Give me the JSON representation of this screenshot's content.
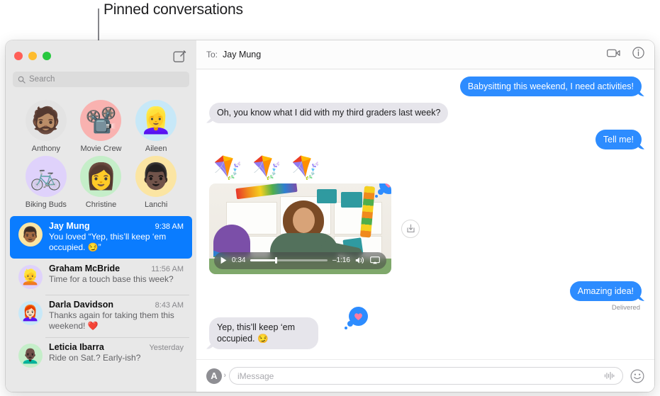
{
  "annotation": {
    "label": "Pinned conversations"
  },
  "window": {
    "traffic_lights": [
      "close",
      "minimize",
      "zoom"
    ],
    "compose_icon": "compose-icon"
  },
  "sidebar": {
    "search": {
      "placeholder": "Search",
      "icon": "search-icon"
    },
    "pinned": [
      {
        "name": "Anthony",
        "emoji": "🧔🏽",
        "bg": "#e3e3e3"
      },
      {
        "name": "Movie Crew",
        "emoji": "📽️",
        "bg": "#f9b2b0"
      },
      {
        "name": "Aileen",
        "emoji": "👱‍♀️",
        "bg": "#c7e8f8"
      },
      {
        "name": "Biking Buds",
        "emoji": "🚲",
        "bg": "#dfd2fb"
      },
      {
        "name": "Christine",
        "emoji": "👩",
        "bg": "#c5eec9"
      },
      {
        "name": "Lanchi",
        "emoji": "👨🏿",
        "bg": "#fbe5a3"
      }
    ],
    "conversations": [
      {
        "name": "Jay Mung",
        "time": "9:38 AM",
        "preview": "You loved “Yep, this’ll keep ‘em occupied. 😏”",
        "emoji": "👨🏾",
        "bg": "#fbe5a3",
        "selected": true
      },
      {
        "name": "Graham McBride",
        "time": "11:56 AM",
        "preview": "Time for a touch base this week?",
        "emoji": "👱",
        "bg": "#dfd2fb",
        "selected": false
      },
      {
        "name": "Darla Davidson",
        "time": "8:43 AM",
        "preview": "Thanks again for taking them this weekend! ❤️",
        "emoji": "👩🏻‍🦰",
        "bg": "#c7e8f8",
        "selected": false
      },
      {
        "name": "Leticia Ibarra",
        "time": "Yesterday",
        "preview": "Ride on Sat.? Early-ish?",
        "emoji": "👨🏿‍🦲",
        "bg": "#c5eec9",
        "selected": false
      }
    ]
  },
  "chat": {
    "to_label": "To:",
    "recipient": "Jay Mung",
    "facetime_icon": "video-camera-icon",
    "info_icon": "info-circle-icon",
    "messages": [
      {
        "dir": "out",
        "text": "Babysitting this weekend, I need activities!"
      },
      {
        "dir": "in",
        "text": "Oh, you know what I did with my third graders last week?"
      },
      {
        "dir": "out",
        "text": "Tell me!"
      }
    ],
    "kites": "🪁🪁🪁",
    "video": {
      "elapsed": "0:34",
      "remaining": "–1:16",
      "play_icon": "play-icon",
      "volume_icon": "volume-icon",
      "airplay_icon": "airplay-icon",
      "reaction": "❤️",
      "save_icon": "download-icon"
    },
    "final_out": {
      "text": "Amazing idea!",
      "status": "Delivered"
    },
    "final_in": {
      "text": "Yep, this’ll keep ‘em occupied. 😏",
      "reaction": "❤️"
    },
    "compose": {
      "apps_label": "A",
      "apps_icon": "app-store-icon",
      "placeholder": "iMessage",
      "audio_icon": "audio-waveform-icon",
      "emoji_icon": "smiley-icon"
    }
  },
  "colors": {
    "accent_blue": "#0a7cff",
    "bubble_out": "#2d8cff",
    "bubble_in": "#e6e5eb",
    "sidebar_bg": "#e8e8e8"
  }
}
